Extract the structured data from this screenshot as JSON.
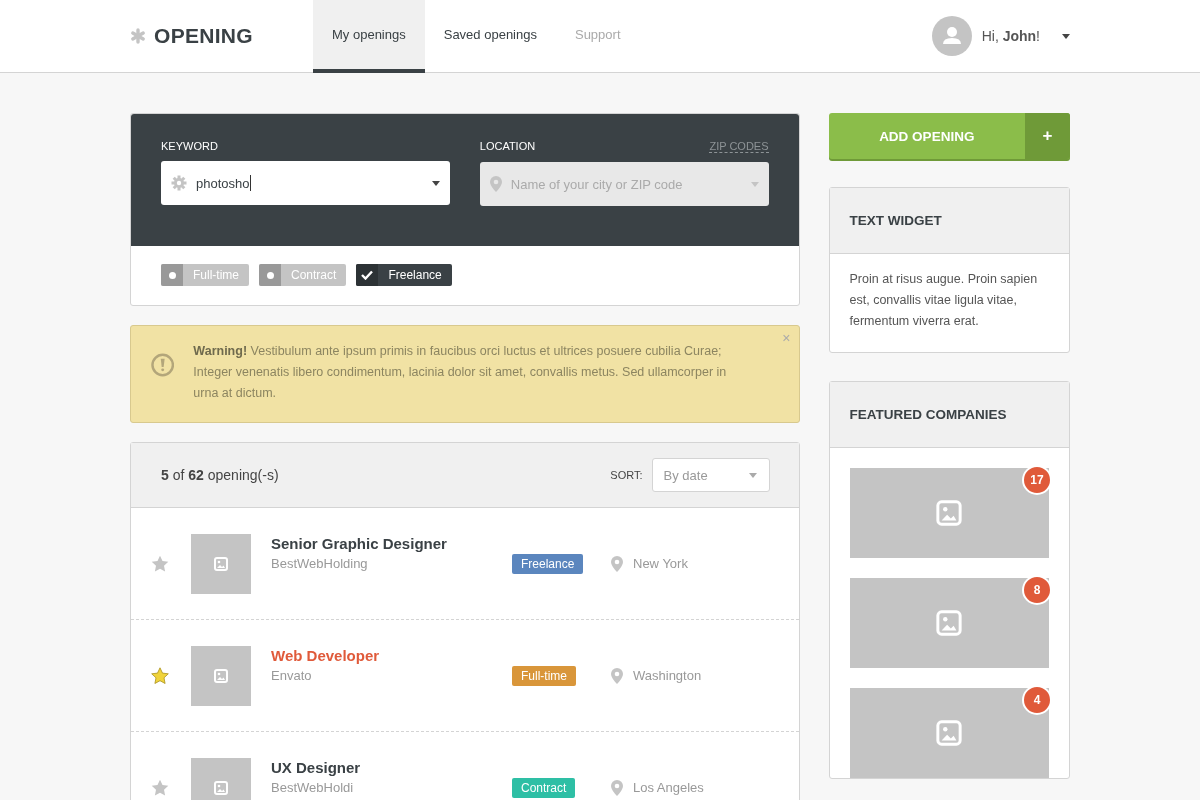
{
  "logo": {
    "text": "OPENING"
  },
  "nav": [
    {
      "label": "My openings",
      "selected": true,
      "disabled": false
    },
    {
      "label": "Saved openings",
      "selected": false,
      "disabled": false
    },
    {
      "label": "Support",
      "selected": false,
      "disabled": true
    }
  ],
  "user": {
    "greeting": "Hi, **John**!"
  },
  "search": {
    "keyword": {
      "label": "KEYWORD",
      "value": "photosho"
    },
    "location": {
      "label": "LOCATION",
      "link": "ZIP CODES",
      "placeholder": "Name of your city or ZIP code",
      "disabled": true
    },
    "filters": [
      {
        "label": "Full-time",
        "checked": false
      },
      {
        "label": "Contract",
        "checked": false
      },
      {
        "label": "Freelance",
        "checked": true
      }
    ]
  },
  "warning": {
    "text": "**Warning!** Vestibulum ante ipsum primis in faucibus orci luctus et ultrices posuere cubilia Curae; Integer venenatis libero condimentum, lacinia dolor sit amet, convallis metus. Sed ullamcorper in urna at dictum.",
    "close": "×"
  },
  "results": {
    "count": "**5** of **62** opening(-s)",
    "sort_label": "SORT:",
    "sort_value": "By date"
  },
  "openings": [
    {
      "title": "Senior Graphic Designer",
      "company": "BestWebHolding",
      "tag": "Freelance",
      "color": "#5b86be",
      "location": "New York",
      "starred": false,
      "selected": false
    },
    {
      "title": "Web Developer",
      "company": "Envato",
      "tag": "Full-time",
      "color": "#d9963a",
      "location": "Washington",
      "starred": true,
      "selected": true
    },
    {
      "title": "UX Designer",
      "company": "BestWebHoldi",
      "tag": "Contract",
      "color": "#2ebfa5",
      "location": "Los Angeles",
      "starred": false,
      "selected": false
    }
  ],
  "add_button": {
    "label": "ADD OPENING",
    "icon": "+"
  },
  "text_widget": {
    "title": "TEXT WIDGET",
    "body": "Proin at risus augue. Proin sapien est, convallis vitae ligula vitae, fermentum viverra erat."
  },
  "featured": {
    "title": "FEATURED COMPANIES",
    "companies": [
      {
        "count": "17"
      },
      {
        "count": "8"
      },
      {
        "count": "4"
      }
    ]
  }
}
